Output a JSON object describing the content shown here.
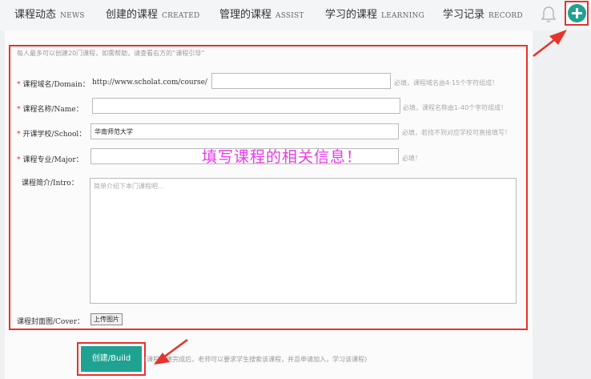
{
  "nav": {
    "tabs": [
      {
        "cn": "课程动态",
        "en": "NEWS"
      },
      {
        "cn": "创建的课程",
        "en": "CREATED"
      },
      {
        "cn": "管理的课程",
        "en": "ASSIST"
      },
      {
        "cn": "学习的课程",
        "en": "LEARNING"
      },
      {
        "cn": "学习记录",
        "en": "RECORD"
      }
    ],
    "bell_icon": "bell-icon",
    "add_icon": "plus-icon"
  },
  "form": {
    "hint": "每人最多可以创建20门课程，如需帮助，请查看右方的“课程引导”",
    "domain": {
      "label": "课程域名/Domain：",
      "prefix": "http://www.scholat.com/course/",
      "value": "",
      "note": "必填，课程域名由4-15个字符组成！"
    },
    "name": {
      "label": "课程名称/Name：",
      "value": "",
      "note": "必填，课程名称由1-40个字符组成！"
    },
    "school": {
      "label": "开课学校/School：",
      "value": "华南师范大学",
      "note": "必填，若找不到对应学校可直接填写！"
    },
    "major": {
      "label": "课程专业/Major：",
      "value": "",
      "note": "必填！"
    },
    "intro": {
      "label": "课程简介/Intro：",
      "placeholder": "简单介绍下本门课程吧..."
    },
    "cover": {
      "label": "课程封面图/Cover：",
      "button": "上传图片"
    },
    "overlay_text": "填写课程的相关信息！",
    "build_button": "创建/Build",
    "build_note": "(课程创建完成后，老师可以要求学生搜索该课程，并且申请加入，学习该课程)"
  },
  "colors": {
    "accent": "#1fa291",
    "highlight": "#e8322c",
    "overlay": "#e83ae8"
  }
}
